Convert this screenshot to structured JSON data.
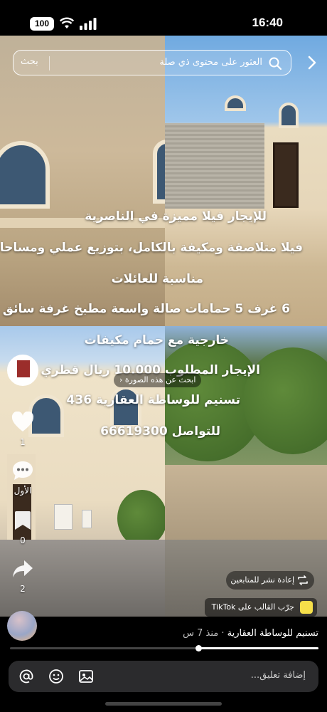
{
  "status": {
    "time": "16:40",
    "battery": "100"
  },
  "search": {
    "placeholder": "العثور على محتوى ذي صلة",
    "button": "بحث"
  },
  "caption": {
    "lines": [
      "للإيجار فيلا مميزة في الناصرية",
      "فيلا متلاصقة ومكيفة بالكامل، بتوزيع عملي ومساحات",
      "مناسبة للعائلات",
      "6 غرف 5 حمامات صالة واسعة مطبخ غرفة سائق",
      "خارجية مع حمام مكيفات",
      "الإيجار المطلوب 10.000 ريال قطري",
      "تسنيم للوساطة العقارية 436",
      "للتواصل 66619300"
    ]
  },
  "find_image": "ابحث عن هذه الصورة",
  "actions": {
    "likes": "1",
    "comments": "الأول",
    "saves": "0",
    "shares": "2"
  },
  "repost": "إعادة نشر للمتابعين",
  "template": "جرّب القالب على TikTok",
  "post": {
    "author": "تسنيم للوساطة العقارية",
    "time": "منذ 7 س",
    "separator": " · ",
    "progress": 0.39
  },
  "comment": {
    "placeholder": "إضافة تعليق..."
  },
  "icons": {
    "back": "chevron-right-icon",
    "search": "search-icon",
    "like": "heart-icon",
    "comment": "comment-bubble-icon",
    "save": "bookmark-icon",
    "share": "share-arrow-icon",
    "mention": "at-icon",
    "emoji": "emoji-icon",
    "image": "image-icon"
  }
}
